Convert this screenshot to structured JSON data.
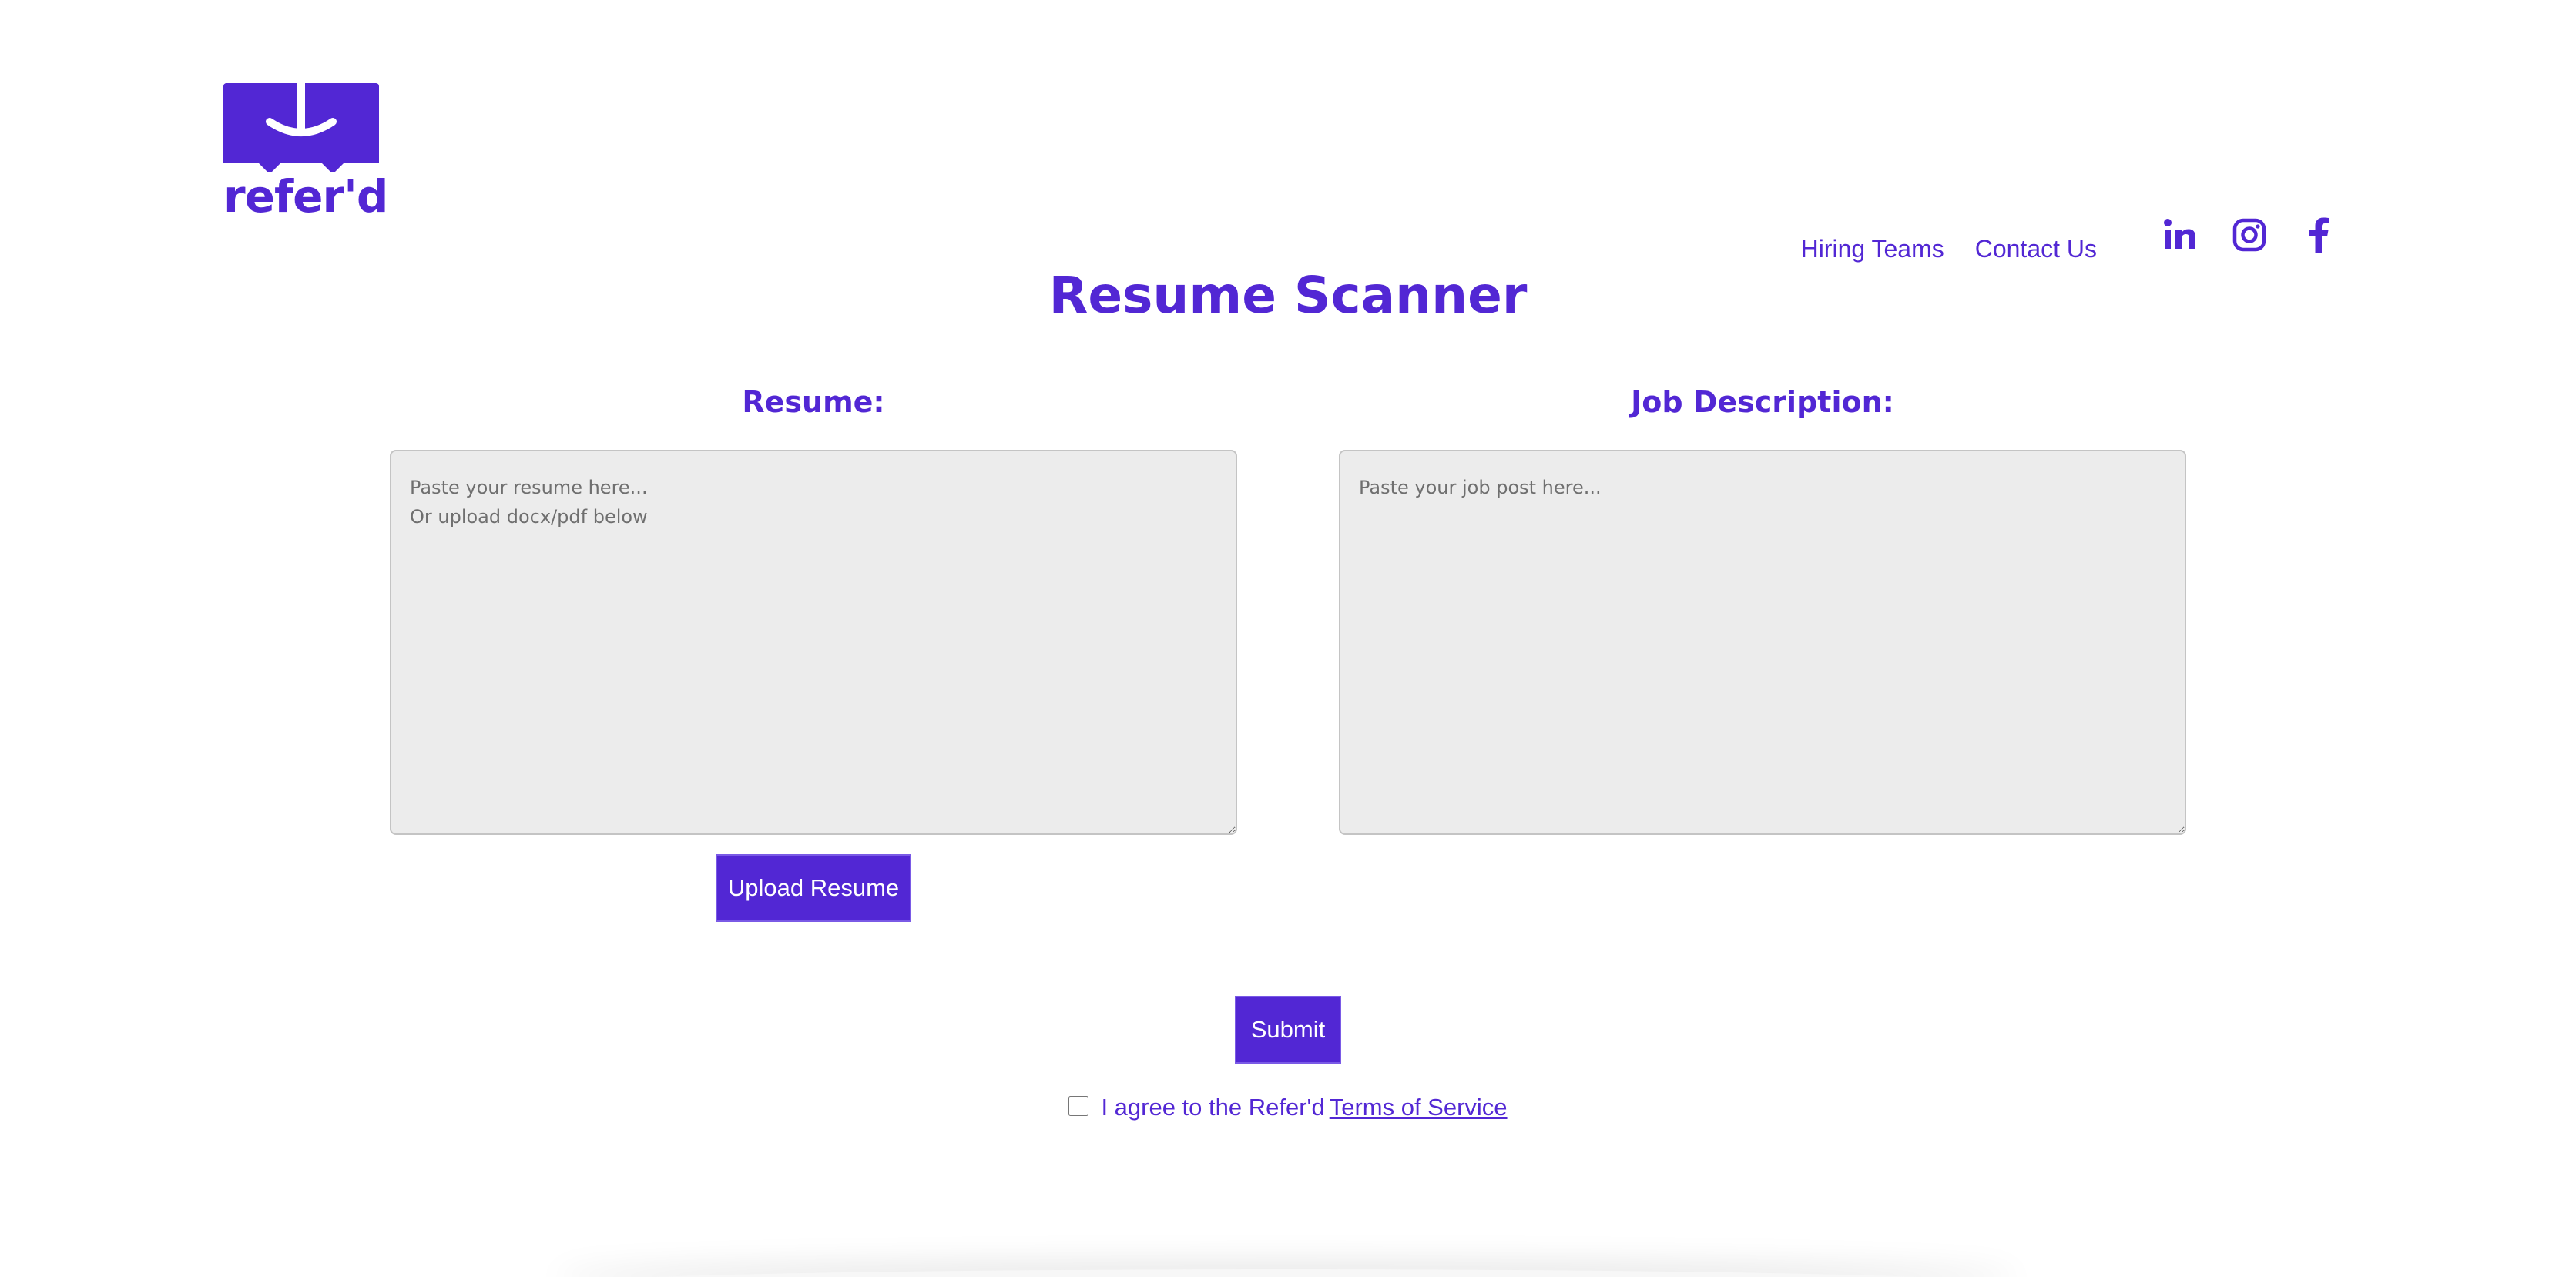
{
  "brand": {
    "name": "refer'd",
    "color": "#5227d4"
  },
  "nav": {
    "links": [
      {
        "label": "Hiring Teams"
      },
      {
        "label": "Contact Us"
      }
    ],
    "social": [
      "linkedin-icon",
      "instagram-icon",
      "facebook-icon"
    ]
  },
  "page": {
    "title": "Resume Scanner"
  },
  "resume": {
    "label": "Resume:",
    "placeholder": "Paste your resume here...\nOr upload docx/pdf below",
    "upload_label": "Upload Resume"
  },
  "job": {
    "label": "Job Description:",
    "placeholder": "Paste your job post here..."
  },
  "form": {
    "submit_label": "Submit",
    "agree_text": "I agree to the Refer'd",
    "terms_link": "Terms of Service"
  }
}
